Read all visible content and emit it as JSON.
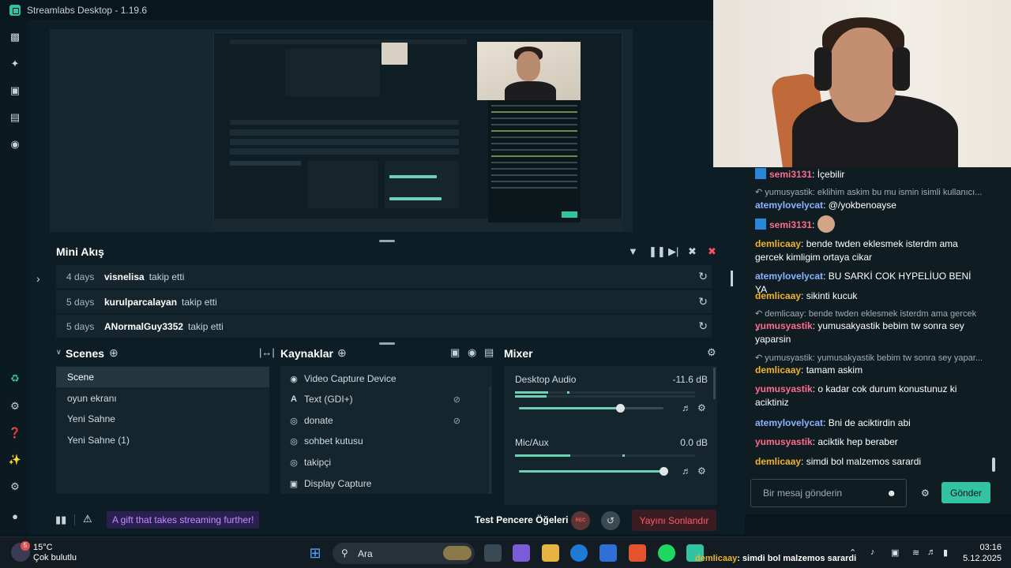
{
  "window": {
    "title": "Streamlabs Desktop - 1.19.6"
  },
  "sidebar": {
    "icons": [
      "editor-icon",
      "themes-icon",
      "store-icon",
      "highlighter-icon",
      "record-icon",
      "cloud-icon",
      "settings-apps-icon",
      "help-icon",
      "ai-icon",
      "settings-icon",
      "profile-icon"
    ]
  },
  "mini_feed": {
    "title": "Mini Akış",
    "items": [
      {
        "age": "4 days",
        "user": "visnelisa",
        "action": "takip etti"
      },
      {
        "age": "5 days",
        "user": "kurulparcalayan",
        "action": "takip etti"
      },
      {
        "age": "5 days",
        "user": "ANormalGuy3352",
        "action": "takip etti"
      }
    ]
  },
  "scenes": {
    "title": "Scenes",
    "items": [
      "Scene",
      "oyun ekranı",
      "Yeni Sahne",
      "Yeni Sahne (1)"
    ],
    "active": "Scene"
  },
  "sources": {
    "title": "Kaynaklar",
    "items": [
      {
        "label": "Video Capture Device",
        "icon": "camera-icon",
        "hidden": false
      },
      {
        "label": "Text (GDI+)",
        "icon": "text-icon",
        "hidden": true
      },
      {
        "label": "donate",
        "icon": "globe-icon",
        "hidden": true
      },
      {
        "label": "sohbet kutusu",
        "icon": "globe-icon",
        "hidden": false
      },
      {
        "label": "takipçi",
        "icon": "globe-icon",
        "hidden": false
      },
      {
        "label": "Display Capture",
        "icon": "monitor-icon",
        "hidden": false
      }
    ]
  },
  "mixer": {
    "title": "Mixer",
    "channels": [
      {
        "name": "Desktop Audio",
        "db": "-11.6 dB",
        "volume": 0.7
      },
      {
        "name": "Mic/Aux",
        "db": "0.0 dB",
        "volume": 1.0
      }
    ]
  },
  "footer": {
    "gift": "A gift that takes streaming further!",
    "test_label": "Test Pencere Öğeleri",
    "rec": "REC",
    "end_stream": "Yayını Sonlandır"
  },
  "chat": {
    "messages": [
      {
        "user": "semi3131",
        "text": "İçebilir",
        "color": "#ff6b8b",
        "reply": false
      },
      {
        "user": "",
        "text": "yumusyastik: eklihim askim bu mu ismin isimli kullanıcı...",
        "color": "#a2adb2",
        "reply": true
      },
      {
        "user": "atemylovelycat",
        "text": "@/yokbenoayse",
        "color": "#8ab4ff",
        "reply": false
      },
      {
        "user": "semi3131",
        "text": "",
        "color": "#ff6b8b",
        "reply": false
      },
      {
        "user": "demlicaay",
        "text": "bende twden eklesmek isterdm ama gercek kimligim ortaya cikar",
        "color": "#f0b429",
        "reply": false
      },
      {
        "user": "atemylovelycat",
        "text": "BU SARKİ COK HYPELİUO BENİ YA",
        "color": "#8ab4ff",
        "reply": false
      },
      {
        "user": "demlicaay",
        "text": "sikinti kucuk",
        "color": "#f0b429",
        "reply": false
      },
      {
        "user": "",
        "text": "demlicaay: bende twden eklesmek isterdm ama gercek ...",
        "color": "#a2adb2",
        "reply": true
      },
      {
        "user": "yumusyastik",
        "text": "yumusakyastik bebim tw sonra sey yaparsin",
        "color": "#ff6b8b",
        "reply": false
      },
      {
        "user": "",
        "text": "yumusyastik: yumusakyastik bebim tw sonra sey yapar...",
        "color": "#a2adb2",
        "reply": true
      },
      {
        "user": "demlicaay",
        "text": "tamam askim",
        "color": "#f0b429",
        "reply": false
      },
      {
        "user": "yumusyastik",
        "text": "o kadar cok durum konustunuz ki aciktiniz",
        "color": "#ff6b8b",
        "reply": false
      },
      {
        "user": "atemylovelycat",
        "text": "Bni de aciktirdin abi",
        "color": "#8ab4ff",
        "reply": false
      },
      {
        "user": "yumusyastik",
        "text": "aciktik hep beraber",
        "color": "#ff6b8b",
        "reply": false
      },
      {
        "user": "demlicaay",
        "text": "simdi bol malzemos sarardi",
        "color": "#f0b429",
        "reply": false
      }
    ],
    "placeholder": "Bir mesaj gönderin",
    "send": "Gönder"
  },
  "taskbar": {
    "weather_temp": "15°C",
    "weather_desc": "Çok bulutlu",
    "weather_badge": "5",
    "search": "Ara",
    "ticker_user": "demlicaay",
    "ticker_text": ": simdi bol malzemos sarardi",
    "time": "03:16",
    "date": "5.12.2025"
  }
}
